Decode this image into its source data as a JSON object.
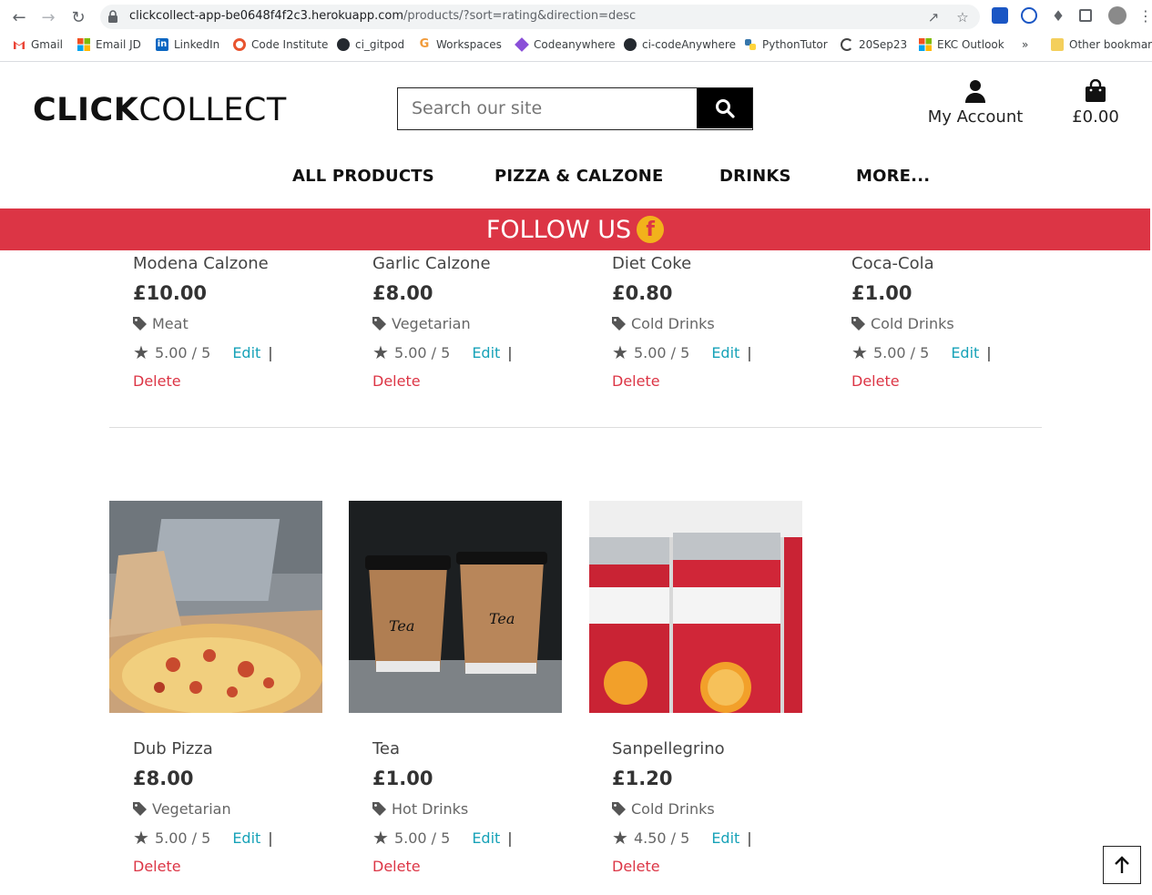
{
  "browser": {
    "url_host": "clickcollect-app-be0648f4f2c3.herokuapp.com",
    "url_path": "/products/?sort=rating&direction=desc",
    "bookmarks": [
      "Gmail",
      "Email JD",
      "LinkedIn",
      "Code Institute",
      "ci_gitpod",
      "Workspaces",
      "Codeanywhere",
      "ci-codeAnywhere",
      "PythonTutor",
      "20Sep23",
      "EKC Outlook"
    ],
    "more": "»",
    "other_bookmarks": "Other bookmarks"
  },
  "site": {
    "logo_bold": "CLICK",
    "logo_light": "COLLECT",
    "search_placeholder": "Search our site",
    "account_label": "My Account",
    "bag_total": "£0.00",
    "nav": [
      "ALL PRODUCTS",
      "PIZZA & CALZONE",
      "DRINKS",
      "MORE..."
    ],
    "follow": "FOLLOW US"
  },
  "products_row1": [
    {
      "name": "Modena Calzone",
      "price": "£10.00",
      "category": "Meat",
      "rating": "5.00 / 5"
    },
    {
      "name": "Garlic Calzone",
      "price": "£8.00",
      "category": "Vegetarian",
      "rating": "5.00 / 5"
    },
    {
      "name": "Diet Coke",
      "price": "£0.80",
      "category": "Cold Drinks",
      "rating": "5.00 / 5"
    },
    {
      "name": "Coca-Cola",
      "price": "£1.00",
      "category": "Cold Drinks",
      "rating": "5.00 / 5"
    }
  ],
  "products_row2": [
    {
      "name": "Dub Pizza",
      "price": "£8.00",
      "category": "Vegetarian",
      "rating": "5.00 / 5"
    },
    {
      "name": "Tea",
      "price": "£1.00",
      "category": "Hot Drinks",
      "rating": "5.00 / 5"
    },
    {
      "name": "Sanpellegrino",
      "price": "£1.20",
      "category": "Cold Drinks",
      "rating": "4.50 / 5"
    }
  ],
  "actions": {
    "edit": "Edit",
    "separator": "|",
    "delete": "Delete"
  },
  "image_text": {
    "tea_cup": "Tea"
  },
  "colors": {
    "accent_red": "#dc3545",
    "link_teal": "#17a2b8",
    "facebook_yellow": "#f2b21b"
  }
}
